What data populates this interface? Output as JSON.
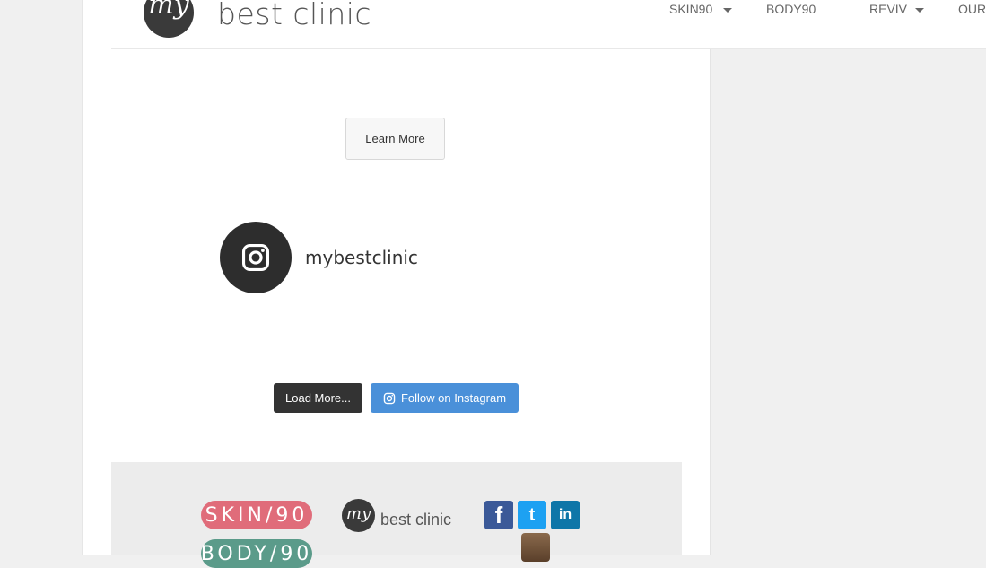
{
  "header": {
    "logo_text": "best clinic",
    "nav": [
      {
        "label": "SKIN90",
        "has_caret": true
      },
      {
        "label": "BODY90",
        "has_caret": false
      },
      {
        "label": "REVIV",
        "has_caret": true
      },
      {
        "label": "OUR",
        "has_caret": false
      }
    ]
  },
  "main": {
    "learn_more_label": "Learn More",
    "instagram": {
      "handle": "mybestclinic",
      "load_more_label": "Load More...",
      "follow_label": "Follow on Instagram"
    }
  },
  "footer": {
    "skin_logo": "SKIN/90",
    "body_logo": "BODY/90",
    "clinic_logo_text": "best clinic",
    "social": [
      "f",
      "t",
      "in"
    ]
  },
  "colors": {
    "follow_button": "#4a90d9",
    "load_button": "#333333",
    "skin_logo": "#e06c7a",
    "body_logo": "#5b9b8a"
  },
  "icons": {
    "instagram": "instagram-icon",
    "facebook": "facebook-icon",
    "twitter": "twitter-icon",
    "linkedin": "linkedin-icon"
  }
}
